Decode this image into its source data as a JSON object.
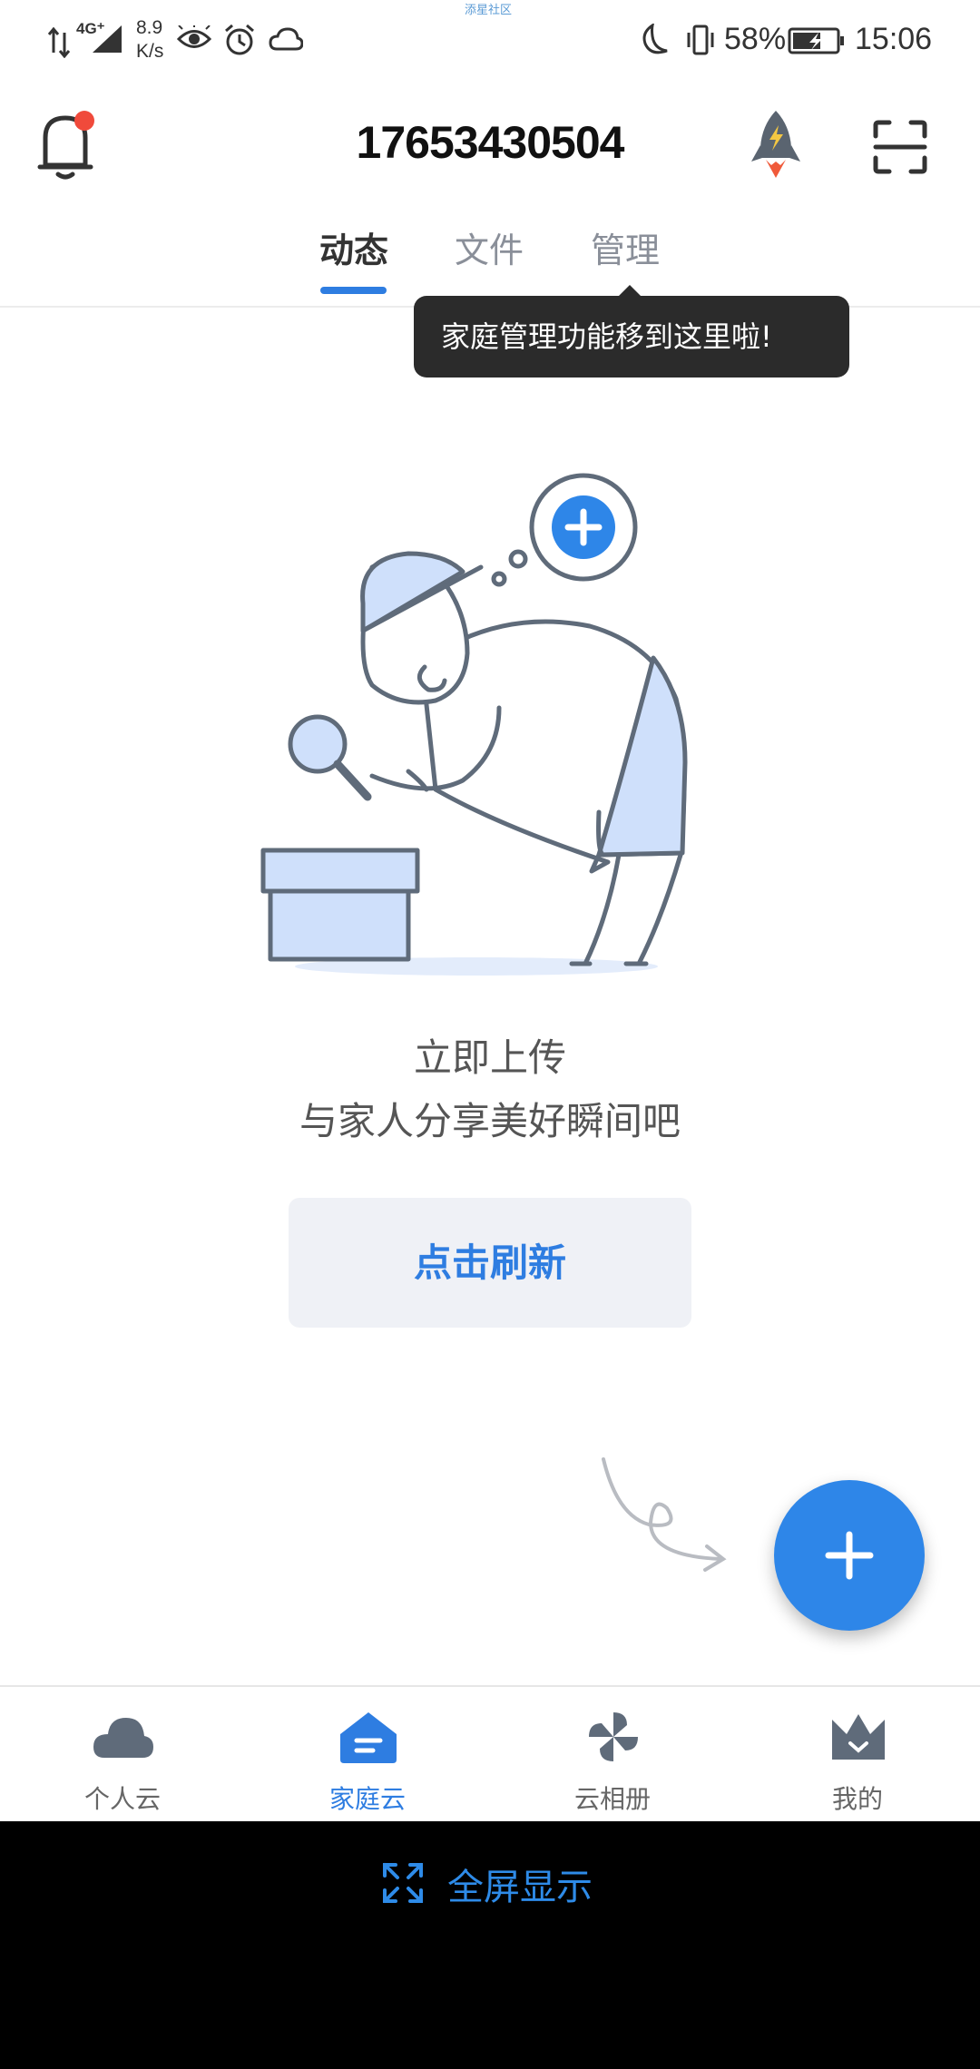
{
  "status_bar": {
    "network": "4G⁺",
    "speed_value": "8.9",
    "speed_unit": "K/s",
    "battery": "58%",
    "time": "15:06",
    "watermark": "添星社区"
  },
  "header": {
    "title": "17653430504",
    "tabs": [
      {
        "label": "动态",
        "active": true
      },
      {
        "label": "文件",
        "active": false
      },
      {
        "label": "管理",
        "active": false
      }
    ],
    "notification_badge_color": "#f04a3b"
  },
  "tooltip": {
    "text": "家庭管理功能移到这里啦!"
  },
  "empty_state": {
    "line1": "立即上传",
    "line2": "与家人分享美好瞬间吧",
    "refresh_label": "点击刷新"
  },
  "bottom_nav": {
    "items": [
      {
        "label": "个人云",
        "icon": "cloud-icon",
        "active": false
      },
      {
        "label": "家庭云",
        "icon": "home-icon",
        "active": true
      },
      {
        "label": "云相册",
        "icon": "pinwheel-icon",
        "active": false
      },
      {
        "label": "我的",
        "icon": "crown-icon",
        "active": false
      }
    ]
  },
  "system_bar": {
    "fullscreen_label": "全屏显示"
  },
  "colors": {
    "accent": "#2e7de1",
    "illustration_fill": "#cfe0fb",
    "illustration_stroke": "#5f6b7a"
  }
}
